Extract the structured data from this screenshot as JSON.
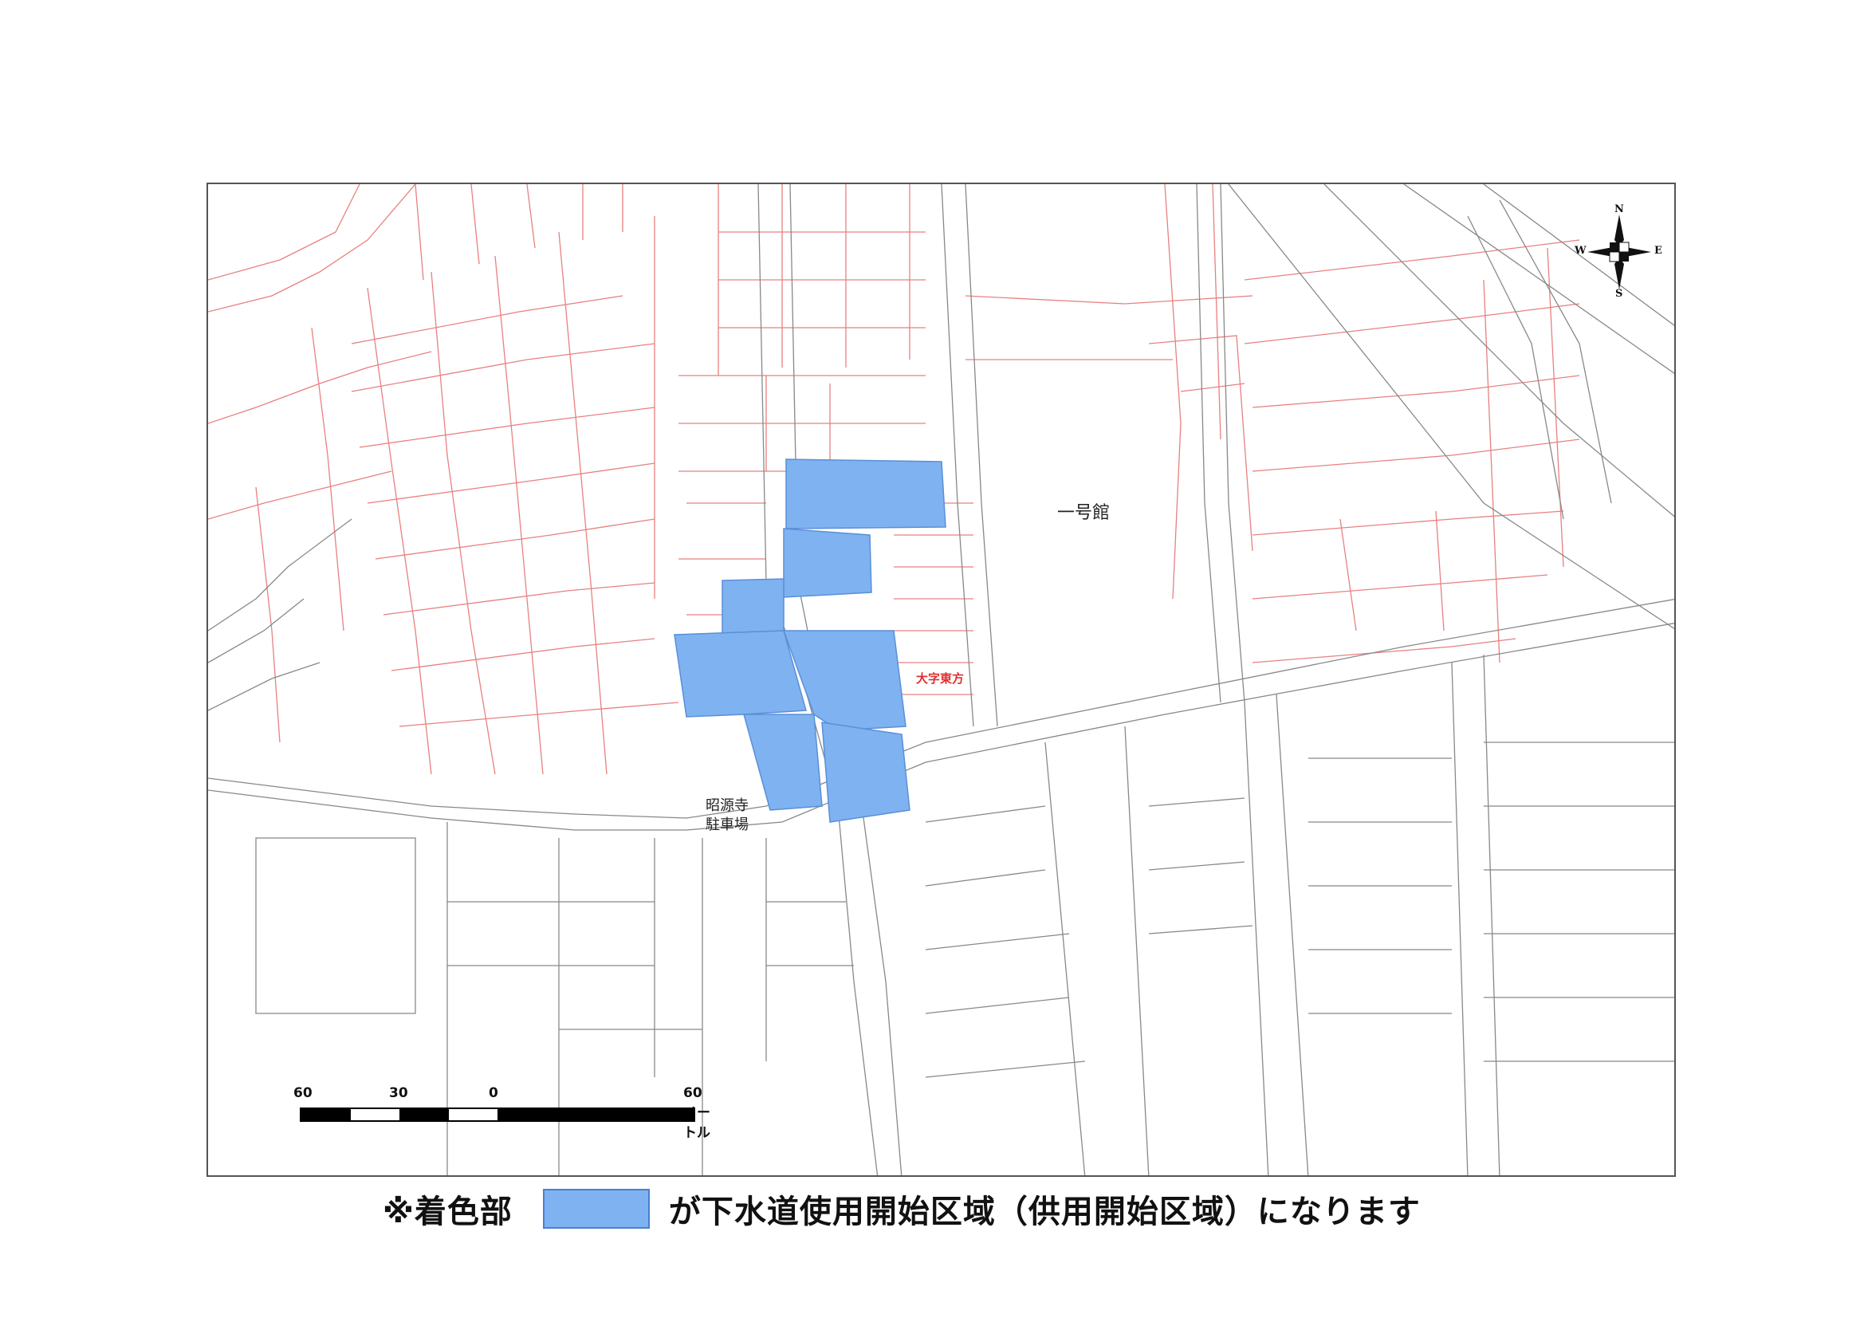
{
  "map": {
    "colors": {
      "served_fill": "#7fb2f0",
      "served_stroke": "#5a8fd8",
      "parcel_line": "#e88080",
      "road_line": "#888888",
      "frame": "#555555"
    },
    "labels": {
      "building": "一号館",
      "lot_line1": "昭源寺",
      "lot_line2": "駐車場",
      "area": "大字東方"
    },
    "compass": {
      "n": "N",
      "s": "S",
      "e": "E",
      "w": "W"
    },
    "scale_bar": {
      "ticks": [
        "60",
        "30",
        "0",
        "60 メートル"
      ]
    }
  },
  "legend": {
    "prefix": "※着色部",
    "suffix": "が下水道使用開始区域（供用開始区域）になります",
    "swatch_color": "#7fb2f0"
  }
}
